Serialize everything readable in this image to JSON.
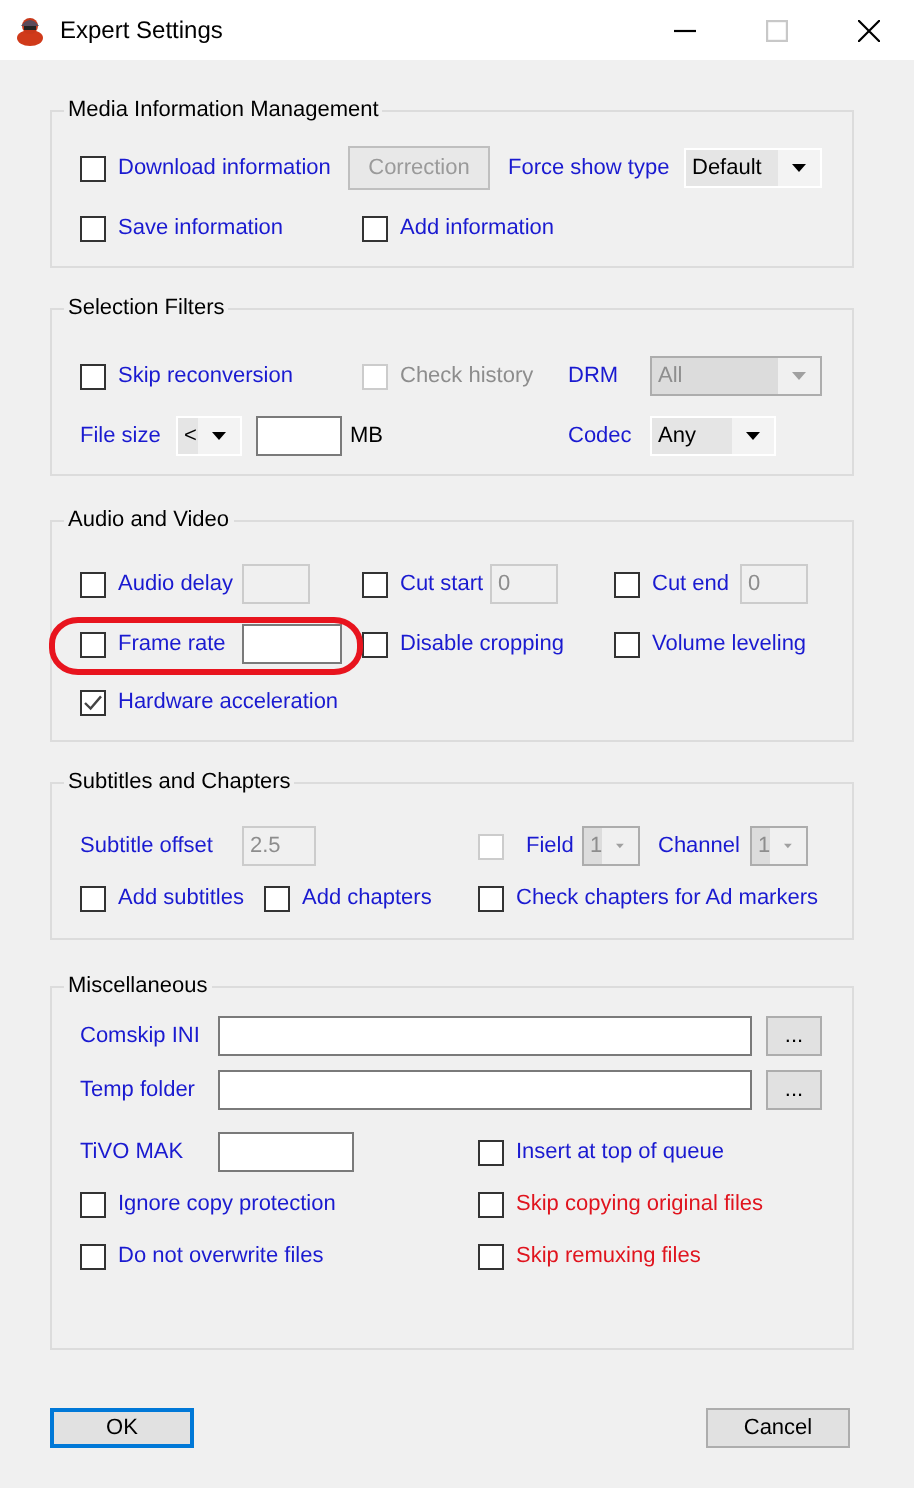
{
  "window": {
    "title": "Expert Settings"
  },
  "media_information": {
    "title": "Media Information Management",
    "download_information": {
      "label": "Download information",
      "checked": false
    },
    "correction_button": {
      "label": "Correction",
      "disabled": true
    },
    "force_show_type": {
      "label": "Force show type",
      "value": "Default",
      "disabled": false
    },
    "save_information": {
      "label": "Save information",
      "checked": false
    },
    "add_information": {
      "label": "Add information",
      "checked": false
    }
  },
  "selection_filters": {
    "title": "Selection Filters",
    "skip_reconversion": {
      "label": "Skip reconversion",
      "checked": false
    },
    "check_history": {
      "label": "Check history",
      "checked": false,
      "disabled": true
    },
    "drm": {
      "label": "DRM",
      "value": "All",
      "disabled": true
    },
    "file_size": {
      "label": "File size",
      "operator": "<",
      "unit": "MB"
    },
    "codec": {
      "label": "Codec",
      "value": "Any",
      "disabled": false
    }
  },
  "audio_video": {
    "title": "Audio and Video",
    "audio_delay": {
      "label": "Audio delay",
      "checked": false,
      "field_disabled": true
    },
    "cut_start": {
      "label": "Cut start",
      "checked": false,
      "value": "0",
      "field_disabled": true
    },
    "cut_end": {
      "label": "Cut end",
      "checked": false,
      "value": "0",
      "field_disabled": true
    },
    "frame_rate": {
      "label": "Frame rate",
      "checked": false,
      "field_disabled": false,
      "highlighted": true
    },
    "disable_cropping": {
      "label": "Disable cropping",
      "checked": false
    },
    "volume_leveling": {
      "label": "Volume leveling",
      "checked": false
    },
    "hardware_acceleration": {
      "label": "Hardware acceleration",
      "checked": true
    }
  },
  "subtitles_chapters": {
    "title": "Subtitles and Chapters",
    "subtitle_offset": {
      "label": "Subtitle offset",
      "value": "2.5",
      "disabled": true
    },
    "field_enable": {
      "checked": false,
      "disabled": true
    },
    "field": {
      "label": "Field",
      "value": "1",
      "disabled": true
    },
    "channel": {
      "label": "Channel",
      "value": "1",
      "disabled": true
    },
    "add_subtitles": {
      "label": "Add subtitles",
      "checked": false
    },
    "add_chapters": {
      "label": "Add chapters",
      "checked": false
    },
    "check_chapters": {
      "label": "Check chapters for Ad markers",
      "checked": false
    }
  },
  "miscellaneous": {
    "title": "Miscellaneous",
    "comskip_ini": {
      "label": "Comskip INI",
      "browse": "..."
    },
    "temp_folder": {
      "label": "Temp folder",
      "browse": "..."
    },
    "tivo_mak": {
      "label": "TiVO MAK"
    },
    "insert_top": {
      "label": "Insert at top of queue",
      "checked": false,
      "caution": false
    },
    "ignore_copy_protection": {
      "label": "Ignore copy protection",
      "checked": false,
      "caution": false
    },
    "skip_copying": {
      "label": "Skip copying original files",
      "checked": false,
      "caution": true
    },
    "do_not_overwrite": {
      "label": "Do not overwrite files",
      "checked": false,
      "caution": false
    },
    "skip_remuxing": {
      "label": "Skip remuxing files",
      "checked": false,
      "caution": true
    }
  },
  "buttons": [
    {
      "label": "OK",
      "default": true
    },
    {
      "label": "Cancel",
      "default": false
    }
  ]
}
